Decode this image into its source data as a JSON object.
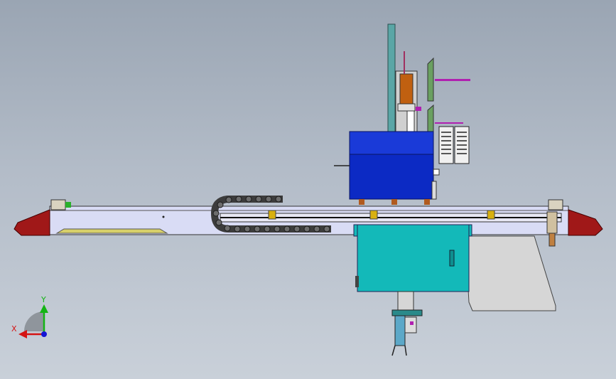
{
  "viewport": {
    "background_top": "#9aa5b3",
    "background_bottom": "#c9d0d9"
  },
  "colors": {
    "beam": "#d9dcf5",
    "end_cap": "#a01818",
    "carriage_blue": "#1030d0",
    "cabinet_teal": "#13b9b9",
    "plate_grey": "#d6d6d6",
    "column_teal": "#5aa6a6",
    "motor_orange": "#c06010",
    "bracket_green": "#6aa060",
    "chain_dark": "#3c3c3c",
    "accent_magenta": "#b020b0",
    "rail_yellow": "#d8d06a"
  },
  "parts": {
    "beam": "horizontal-beam",
    "cable_chain": "cable-drag-chain",
    "carriage": "z-axis-carriage-box",
    "cabinet": "control-cabinet",
    "column": "vertical-column",
    "gripper": "end-effector-gripper"
  },
  "triad": {
    "x_label": "X",
    "y_label": "Y",
    "x_color": "#d41414",
    "y_color": "#14b414",
    "z_color": "#1414d4"
  }
}
